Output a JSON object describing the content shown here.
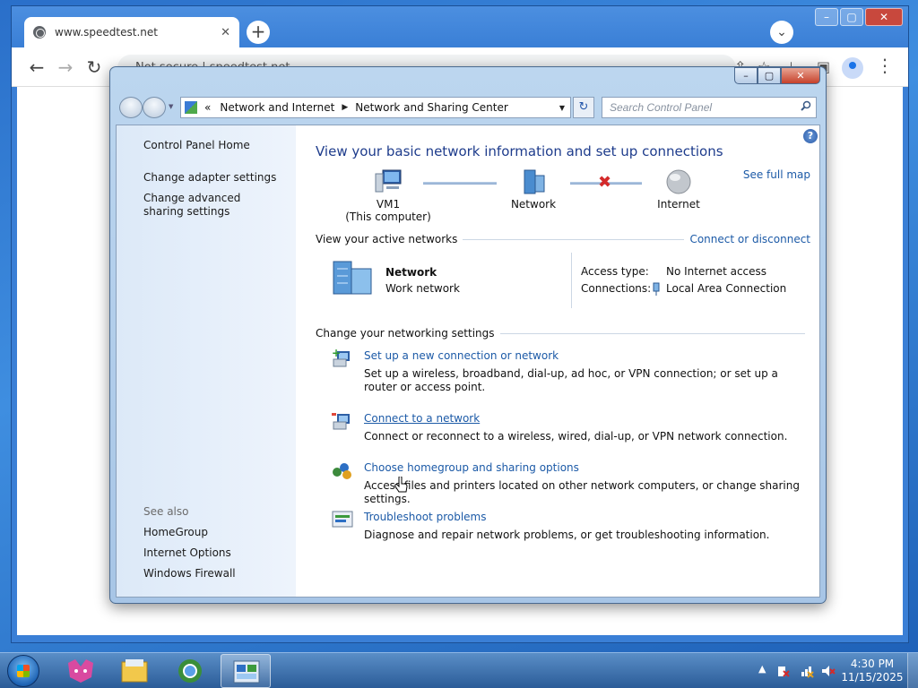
{
  "browser": {
    "tab_title": "www.speedtest.net",
    "tab_close": "✕",
    "new_tab": "+",
    "tab_search": "⌄",
    "controls": {
      "minimize": "–",
      "maximize": "▢",
      "close": "✕"
    },
    "back": "←",
    "forward": "→",
    "reload": "↻",
    "address": "Not secure | speedtest.net",
    "menu": "⋮"
  },
  "cp": {
    "controls": {
      "minimize": "–",
      "maximize": "▢",
      "close": "✕"
    },
    "breadcrumb": {
      "prefix": "«",
      "part1": "Network and Internet",
      "separator": "▶",
      "part2": "Network and Sharing Center",
      "dropdown": "▼"
    },
    "refresh": "↻",
    "search_placeholder": "Search Control Panel",
    "left": {
      "home": "Control Panel Home",
      "change_adapter": "Change adapter settings",
      "change_advanced": "Change advanced sharing settings",
      "see_also": "See also",
      "homegroup": "HomeGroup",
      "internet_options": "Internet Options",
      "windows_firewall": "Windows Firewall"
    },
    "main": {
      "help": "?",
      "title": "View your basic network information and set up connections",
      "see_full_map": "See full map",
      "map": {
        "computer_name": "VM1",
        "computer_sub": "(This computer)",
        "network": "Network",
        "internet": "Internet",
        "broken": "✖"
      },
      "active_networks": {
        "heading": "View your active networks",
        "connect_link": "Connect or disconnect",
        "network_name": "Network",
        "network_type": "Work network",
        "access_type_label": "Access type:",
        "access_type_value": "No Internet access",
        "connections_label": "Connections:",
        "connections_value": "Local Area Connection"
      },
      "settings": {
        "heading": "Change your networking settings",
        "tasks": [
          {
            "title": "Set up a new connection or network",
            "desc": "Set up a wireless, broadband, dial-up, ad hoc, or VPN connection; or set up a router or access point."
          },
          {
            "title": "Connect to a network",
            "desc": "Connect or reconnect to a wireless, wired, dial-up, or VPN network connection."
          },
          {
            "title": "Choose homegroup and sharing options",
            "desc": "Access files and printers located on other network computers, or change sharing settings."
          },
          {
            "title": "Troubleshoot problems",
            "desc": "Diagnose and repair network problems, or get troubleshooting information."
          }
        ]
      }
    }
  },
  "taskbar": {
    "tray_arrow": "▲",
    "time": "4:30 PM",
    "date": "11/15/2025"
  }
}
